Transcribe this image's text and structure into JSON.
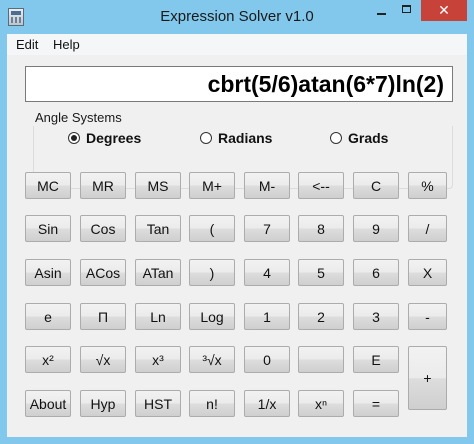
{
  "window": {
    "title": "Expression Solver v1.0"
  },
  "titlebar_buttons": {
    "minimize": "",
    "maximize": "",
    "close": "✕"
  },
  "menu": {
    "items": [
      "Edit",
      "Help"
    ]
  },
  "display": {
    "expression": "cbrt(5/6)atan(6*7)ln(2)"
  },
  "angle_systems": {
    "label": "Angle Systems",
    "options": [
      "Degrees",
      "Radians",
      "Grads"
    ],
    "selected": "Degrees"
  },
  "keypad": {
    "rows": [
      [
        "MC",
        "MR",
        "MS",
        "M+",
        "M-",
        "<--",
        "C",
        "%"
      ],
      [
        "Sin",
        "Cos",
        "Tan",
        "(",
        "7",
        "8",
        "9",
        "/"
      ],
      [
        "Asin",
        "ACos",
        "ATan",
        ")",
        "4",
        "5",
        "6",
        "X"
      ],
      [
        "e",
        "Π",
        "Ln",
        "Log",
        "1",
        "2",
        "3",
        "-"
      ],
      [
        "x²",
        "√x",
        "x³",
        "³√x",
        "0",
        "",
        "E",
        "+"
      ],
      [
        "About",
        "Hyp",
        "HST",
        "n!",
        "1/x",
        "xⁿ",
        "="
      ]
    ]
  }
}
